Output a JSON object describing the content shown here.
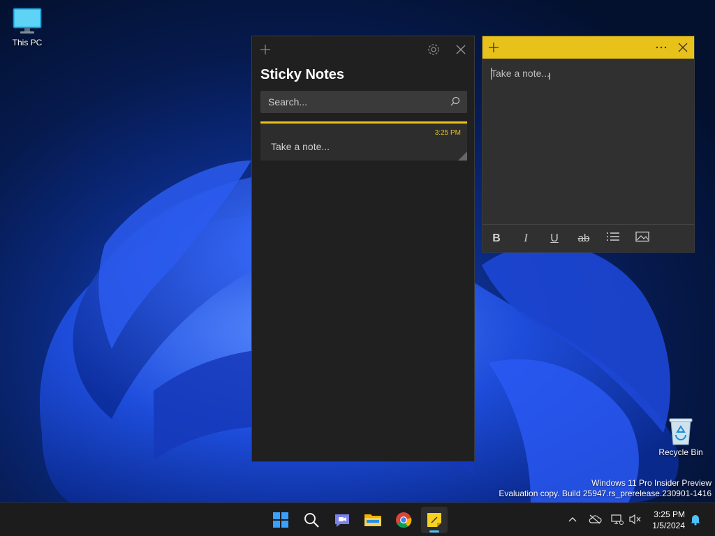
{
  "desktop": {
    "icons": [
      {
        "label": "This PC"
      },
      {
        "label": "Recycle Bin"
      }
    ],
    "watermark": {
      "line1": "Windows 11 Pro Insider Preview",
      "line2": "Evaluation copy. Build 25947.rs_prerelease.230901-1416"
    }
  },
  "sticky_list": {
    "title": "Sticky Notes",
    "search_placeholder": "Search...",
    "notes": [
      {
        "time": "3:25 PM",
        "text": "Take a note..."
      }
    ]
  },
  "note_window": {
    "placeholder": "Take a note...",
    "toolbar": {
      "bold": "B",
      "italic": "I",
      "underline": "U",
      "strikethrough": "ab"
    }
  },
  "taskbar": {
    "time": "3:25 PM",
    "date": "1/5/2024"
  },
  "colors": {
    "note_yellow": "#e8c21b",
    "window_bg": "#202020",
    "taskbar_bg": "#1c1c1c",
    "accent_blue": "#4cc2ff"
  }
}
